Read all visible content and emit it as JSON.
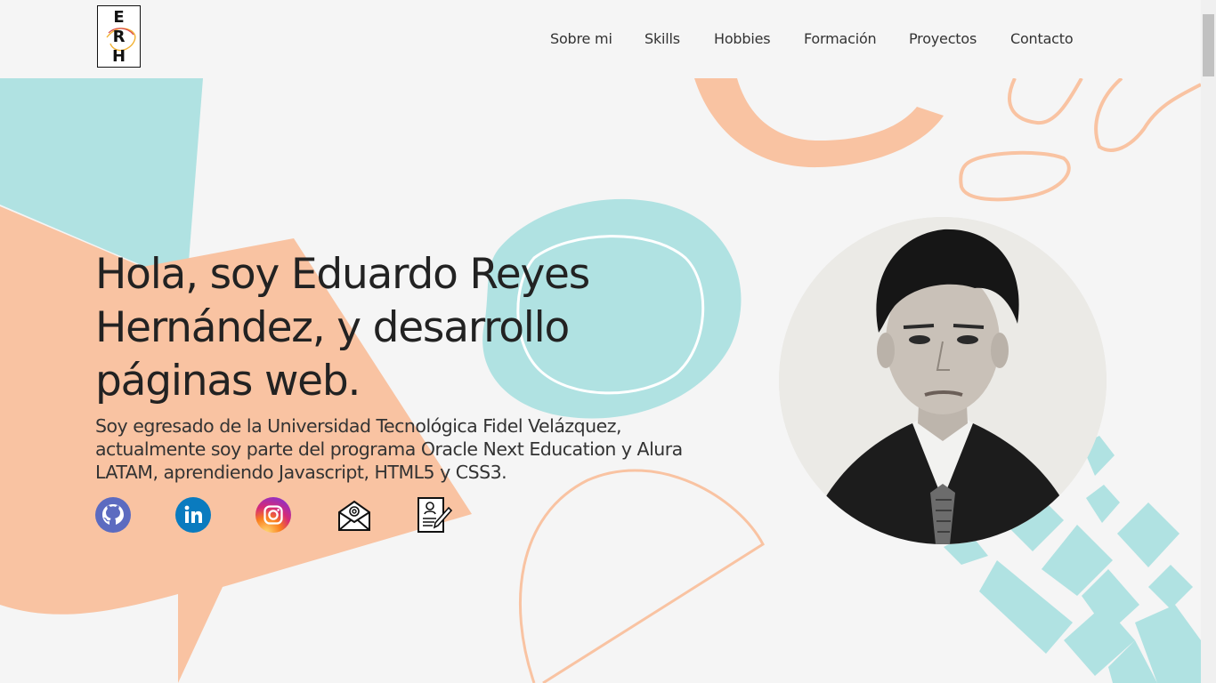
{
  "logo": {
    "letters": [
      "E",
      "R",
      "H"
    ]
  },
  "nav": {
    "items": [
      {
        "label": "Sobre mi"
      },
      {
        "label": "Skills"
      },
      {
        "label": "Hobbies"
      },
      {
        "label": "Formación"
      },
      {
        "label": "Proyectos"
      },
      {
        "label": "Contacto"
      }
    ]
  },
  "hero": {
    "title": "Hola, soy Eduardo Reyes Hernández, y desarrollo páginas web.",
    "description": "Soy egresado de la Universidad Tecnológica Fidel Velázquez, actualmente soy parte del programa Oracle Next Education y Alura LATAM, aprendiendo Javascript, HTML5 y CSS3."
  },
  "socials": [
    {
      "icon": "github-icon",
      "color": "#5c6bc0"
    },
    {
      "icon": "linkedin-icon",
      "color": "#0a7bbf"
    },
    {
      "icon": "instagram-icon",
      "color": "#d62976"
    },
    {
      "icon": "email-icon",
      "color": "#111111"
    },
    {
      "icon": "cv-document-icon",
      "color": "#111111"
    }
  ],
  "colors": {
    "background": "#f5f5f5",
    "teal": "#b0e2e2",
    "peach": "#f9c3a2"
  }
}
